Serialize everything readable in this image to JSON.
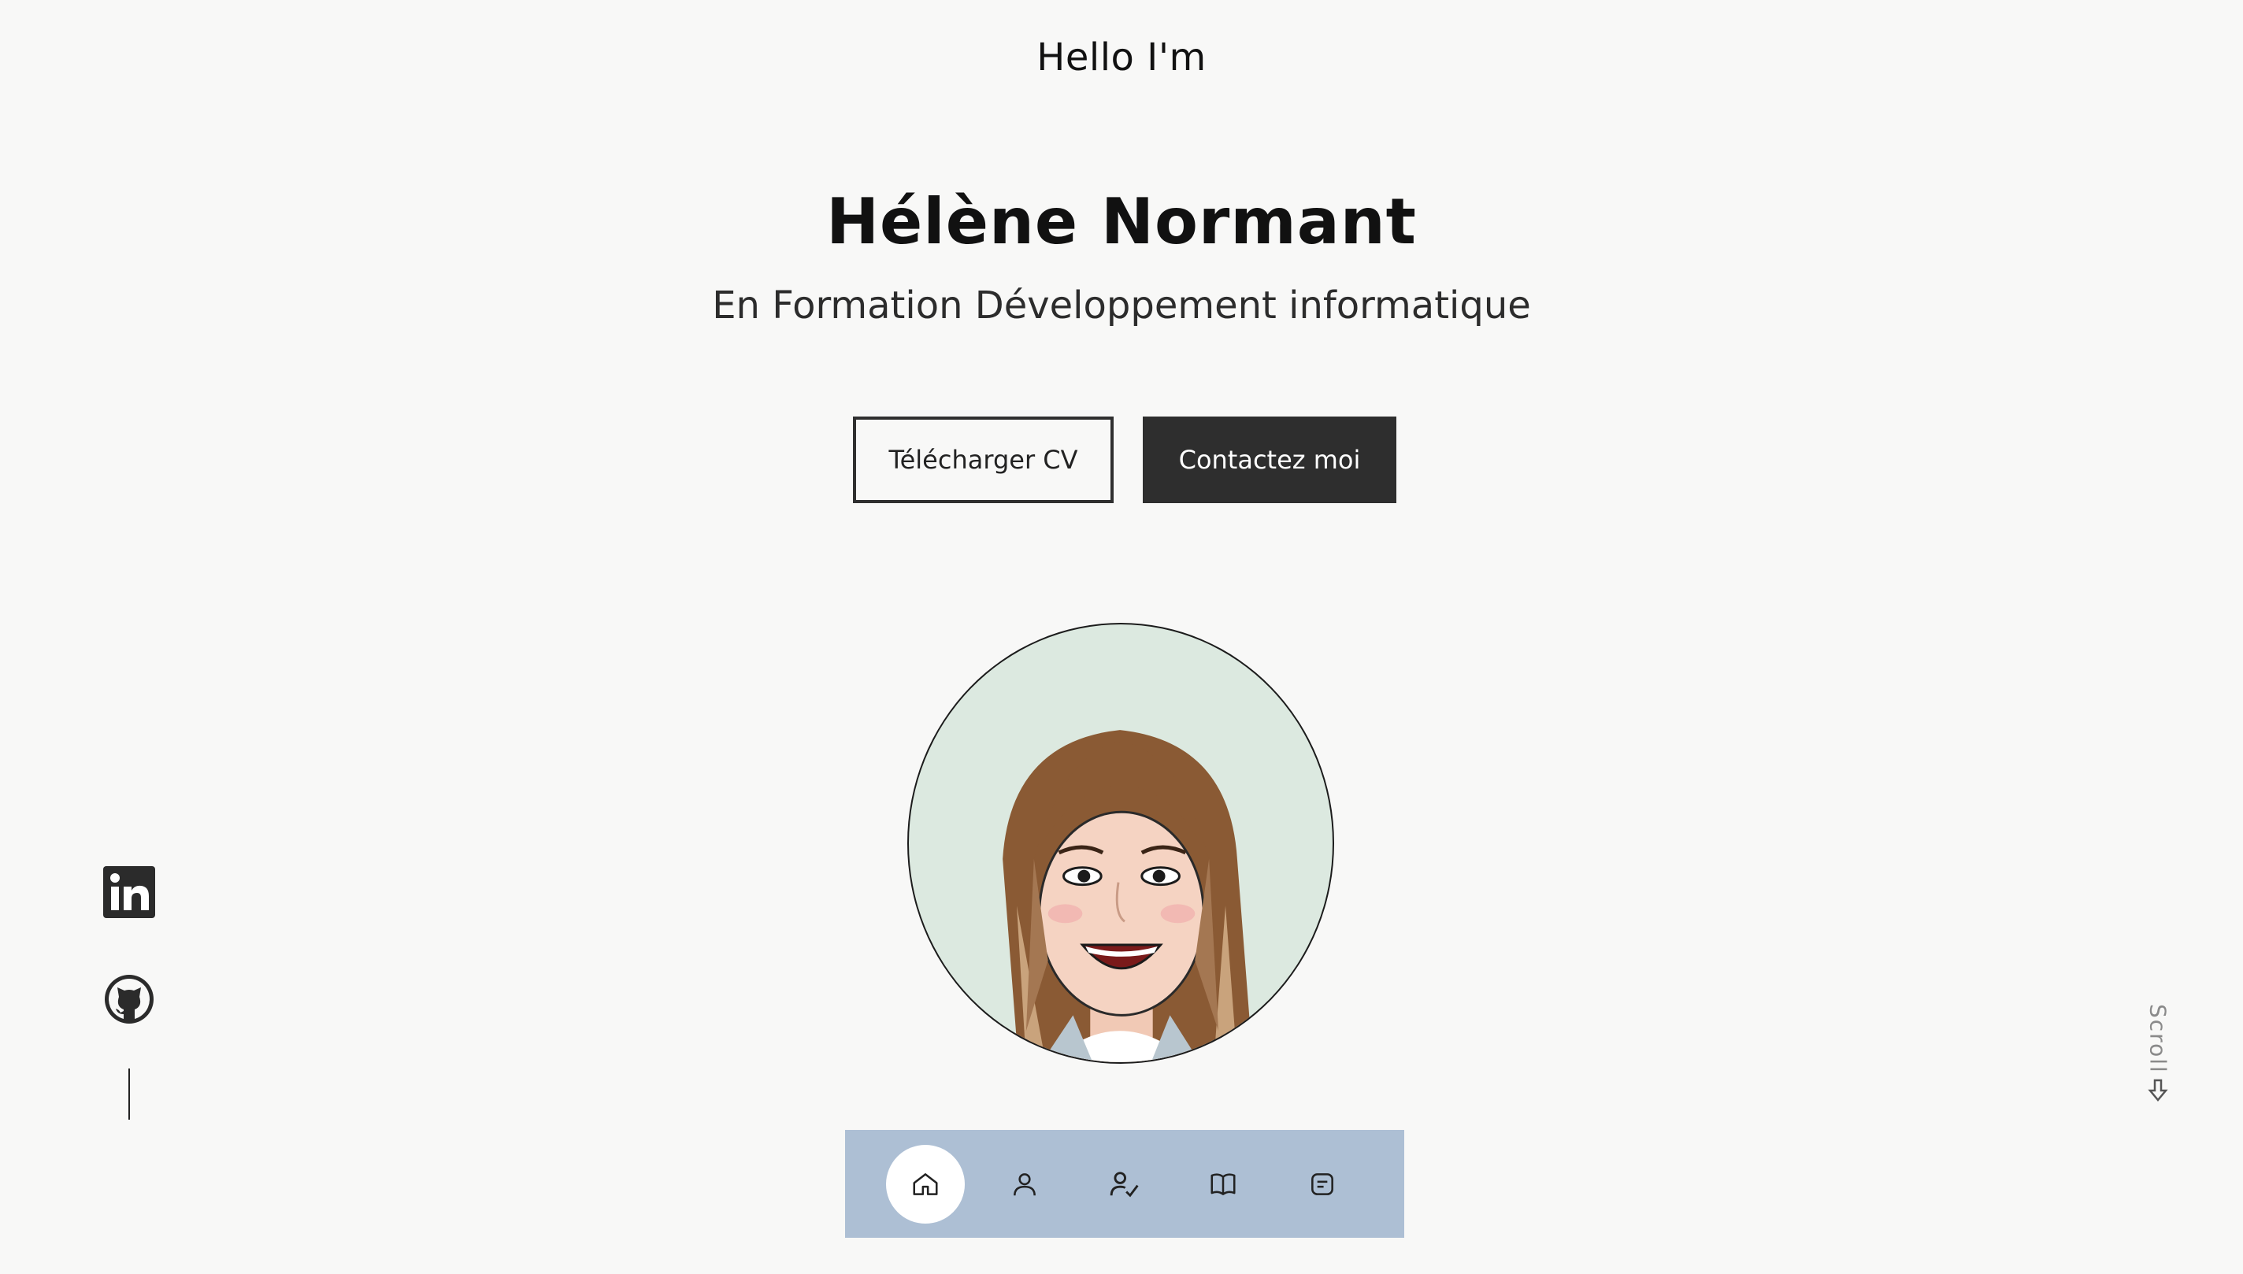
{
  "hero": {
    "greeting": "Hello I'm",
    "name": "Hélène Normant",
    "subtitle": "En Formation Développement informatique"
  },
  "buttons": {
    "download_cv": "Télécharger CV",
    "contact": "Contactez moi"
  },
  "social": {
    "items": [
      {
        "name": "LinkedIn",
        "icon": "linkedin-icon"
      },
      {
        "name": "GitHub",
        "icon": "github-icon"
      }
    ]
  },
  "scroll": {
    "label": "Scroll",
    "icon": "arrow-down-icon"
  },
  "nav": {
    "items": [
      {
        "icon": "home-icon",
        "active": true
      },
      {
        "icon": "user-icon",
        "active": false
      },
      {
        "icon": "user-check-icon",
        "active": false
      },
      {
        "icon": "book-icon",
        "active": false
      },
      {
        "icon": "message-icon",
        "active": false
      }
    ]
  },
  "colors": {
    "background": "#f8f8f7",
    "button_dark": "#2e2e2e",
    "nav_background": "#adbfd4",
    "avatar_background": "#dce9e0"
  }
}
